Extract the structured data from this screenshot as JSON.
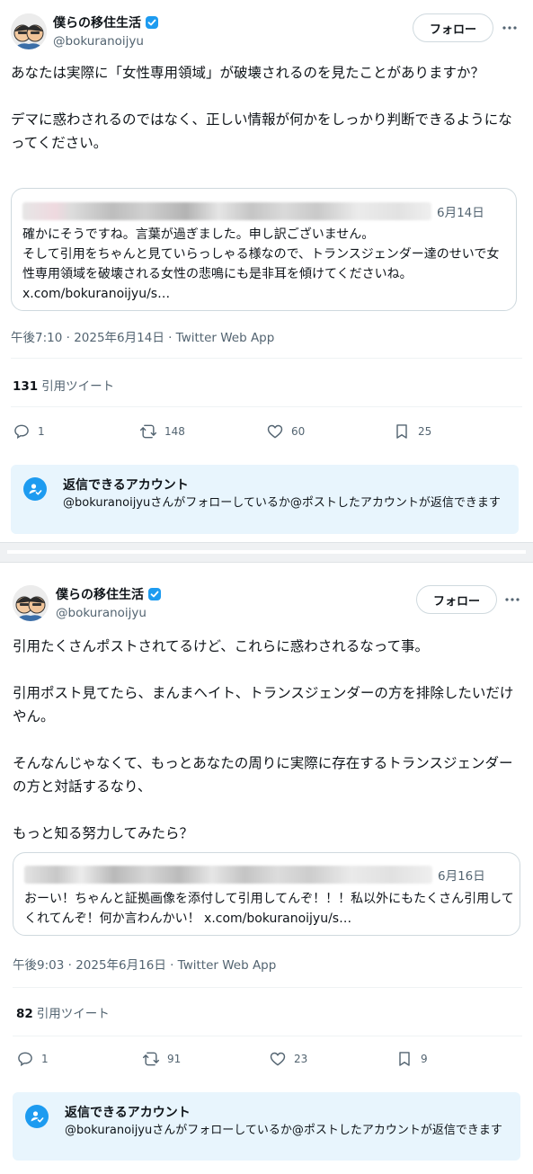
{
  "tweets": [
    {
      "author": {
        "display_name": "僕らの移住生活",
        "handle": "@bokuranoijyu",
        "verified": true
      },
      "follow_label": "フォロー",
      "body": "あなたは実際に「女性専用領域」が破壊されるのを見たことがありますか？\n\nデマに惑わされるのではなく、正しい情報が何かをしっかり判断できるようになってください。",
      "quote": {
        "date": "6月14日",
        "text": "確かにそうですね。言葉が過ぎました。申し訳ございません。\nそして引用をちゃんと見ていらっしゃる様なので、トランスジェンダー達のせいで女性専用領域を破壊される女性の悲鳴にも是非耳を傾けてくださいね。\nx.com/bokuranoijyu/s…"
      },
      "timestamp": "午後7:10 · 2025年6月14日 · Twitter Web App",
      "quote_tweets": {
        "count": "131",
        "label": "引用ツイート"
      },
      "actions": {
        "replies": "1",
        "retweets": "148",
        "likes": "60",
        "bookmarks": "25"
      },
      "reply_restriction": {
        "title": "返信できるアカウント",
        "description": "@bokuranoijyuさんがフォローしているか@ポストしたアカウントが返信できます"
      }
    },
    {
      "author": {
        "display_name": "僕らの移住生活",
        "handle": "@bokuranoijyu",
        "verified": true
      },
      "follow_label": "フォロー",
      "body": "引用たくさんポストされてるけど、これらに惑わされるなって事。\n\n引用ポスト見てたら、まんまヘイト、トランスジェンダーの方を排除したいだけやん。\n\nそんなんじゃなくて、もっとあなたの周りに実際に存在するトランスジェンダーの方と対話するなり、\n\nもっと知る努力してみたら？",
      "quote": {
        "date": "6月16日",
        "text": "おーい！ちゃんと証拠画像を添付して引用してんぞ！！！私以外にもたくさん引用してくれてんぞ！何か言わんかい！ x.com/bokuranoijyu/s…"
      },
      "timestamp": "午後9:03 · 2025年6月16日 · Twitter Web App",
      "quote_tweets": {
        "count": "82",
        "label": "引用ツイート"
      },
      "actions": {
        "replies": "1",
        "retweets": "91",
        "likes": "23",
        "bookmarks": "9"
      },
      "reply_restriction": {
        "title": "返信できるアカウント",
        "description": "@bokuranoijyuさんがフォローしているか@ポストしたアカウントが返信できます"
      }
    }
  ],
  "colors": {
    "accent": "#1d9bf0",
    "secondary_text": "#536471",
    "reply_box_bg": "#e8f5fd"
  },
  "icons": [
    "avatar",
    "verified-badge-icon",
    "more-icon",
    "reply-icon",
    "retweet-icon",
    "like-icon",
    "bookmark-icon",
    "person-check-icon"
  ]
}
